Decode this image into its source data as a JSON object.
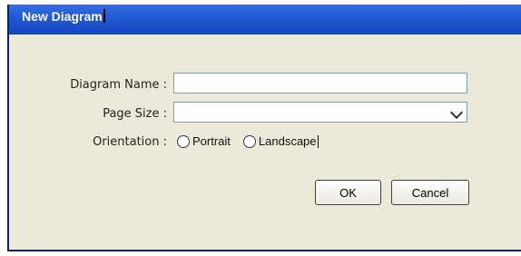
{
  "dialog": {
    "title": "New Diagram",
    "labels": {
      "diagram_name": "Diagram Name :",
      "page_size": "Page Size :",
      "orientation": "Orientation :"
    },
    "fields": {
      "diagram_name_value": "",
      "page_size_value": ""
    },
    "orientation_options": [
      {
        "label": "Portrait",
        "selected": false
      },
      {
        "label": "Landscape",
        "selected": false
      }
    ],
    "buttons": {
      "ok": "OK",
      "cancel": "Cancel"
    }
  }
}
